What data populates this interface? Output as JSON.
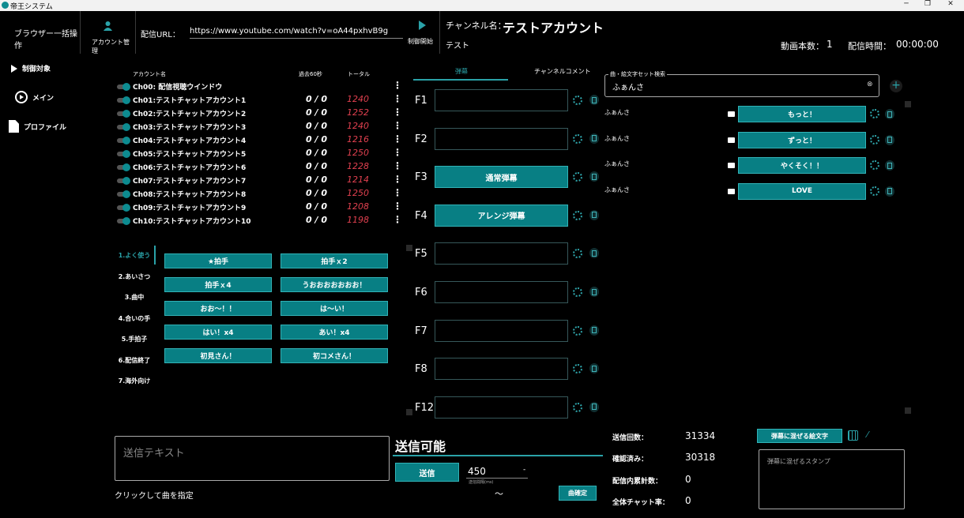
{
  "app": {
    "title": "帝王システム"
  },
  "header": {
    "bulk_label": "ブラウザー一括操作",
    "account_mgmt_label": "アカウント管理",
    "url_label": "配信URL：",
    "url_value": "https://www.youtube.com/watch?v=oA44pxhvB9g",
    "control_start_label": "制御開始",
    "channel_label": "チャンネル名：",
    "channel_value": "テストアカウント",
    "sub_value": "テスト",
    "video_count_label": "動画本数：",
    "video_count_value": "1",
    "time_label": "配信時間：",
    "time_value": "00:00:00"
  },
  "sidebar": {
    "items": [
      {
        "label": "制御対象",
        "icon": "play-icon"
      },
      {
        "label": "メイン",
        "icon": "circle-play-icon"
      },
      {
        "label": "プロファイル",
        "icon": "document-icon"
      }
    ]
  },
  "accounts": {
    "headers": {
      "name": "アカウント名",
      "past60": "過去60秒",
      "total": "トータル"
    },
    "rows": [
      {
        "name": "Ch00: 配信視聴ウインドウ",
        "past": "",
        "total": ""
      },
      {
        "name": "Ch01:テストチャットアカウント1",
        "past": "0 / 0",
        "total": "1240"
      },
      {
        "name": "Ch02:テストチャットアカウント2",
        "past": "0 / 0",
        "total": "1252"
      },
      {
        "name": "Ch03:テストチャットアカウント3",
        "past": "0 / 0",
        "total": "1240"
      },
      {
        "name": "Ch04:テストチャットアカウント4",
        "past": "0 / 0",
        "total": "1216"
      },
      {
        "name": "Ch05:テストチャットアカウント5",
        "past": "0 / 0",
        "total": "1250"
      },
      {
        "name": "Ch06:テストチャットアカウント6",
        "past": "0 / 0",
        "total": "1228"
      },
      {
        "name": "Ch07:テストチャットアカウント7",
        "past": "0 / 0",
        "total": "1214"
      },
      {
        "name": "Ch08:テストチャットアカウント8",
        "past": "0 / 0",
        "total": "1250"
      },
      {
        "name": "Ch09:テストチャットアカウント9",
        "past": "0 / 0",
        "total": "1208"
      },
      {
        "name": "Ch10:テストチャットアカウント10",
        "past": "0 / 0",
        "total": "1198"
      }
    ]
  },
  "categories": [
    "1.よく使う",
    "2.あいさつ",
    "3.曲中",
    "4.合いの手",
    "5.手拍子",
    "6.配信終了",
    "7.海外向け"
  ],
  "phrases": [
    "★拍手",
    "拍手ｘ2",
    "拍手ｘ4",
    "うおおおおおおお！",
    "おお〜！！",
    "は〜い！",
    "はい！x4",
    "あい！x4",
    "初見さん！",
    "初コメさん！"
  ],
  "tabs": {
    "danmaku": "弾幕",
    "channel_comment": "チャンネルコメント"
  },
  "fkeys": [
    {
      "key": "F1",
      "label": ""
    },
    {
      "key": "F2",
      "label": ""
    },
    {
      "key": "F3",
      "label": "通常弾幕"
    },
    {
      "key": "F4",
      "label": "アレンジ弾幕"
    },
    {
      "key": "F5",
      "label": ""
    },
    {
      "key": "F6",
      "label": ""
    },
    {
      "key": "F7",
      "label": ""
    },
    {
      "key": "F8",
      "label": ""
    },
    {
      "key": "F12",
      "label": ""
    }
  ],
  "search": {
    "label": "曲・絵文字セット検索",
    "value": "ふぁんさ"
  },
  "results": {
    "channel": "ふぁんさ",
    "items": [
      "もっと！",
      "ずっと！",
      "やくそく！！",
      "LOVE"
    ]
  },
  "send": {
    "placeholder": "送信テキスト",
    "status": "送信可能",
    "button": "送信",
    "interval_value": "450",
    "interval_label": "送信間隔(ms)",
    "song_hint": "クリックして曲を指定",
    "tilde": "〜",
    "confirm_button": "曲確定"
  },
  "stats": {
    "send_count_label": "送信回数：",
    "send_count": "31334",
    "confirmed_label": "確認済み：",
    "confirmed": "30318",
    "cum_label": "配信内累計数：",
    "cum": "0",
    "rate_label": "全体チャット率：",
    "rate": "0"
  },
  "emoji": {
    "button": "弾幕に混ぜる絵文字",
    "stamp_placeholder": "弾幕に混ぜるスタンプ"
  },
  "colors": {
    "accent": "#087f84",
    "danger": "#e0404f",
    "bg": "#000000"
  }
}
